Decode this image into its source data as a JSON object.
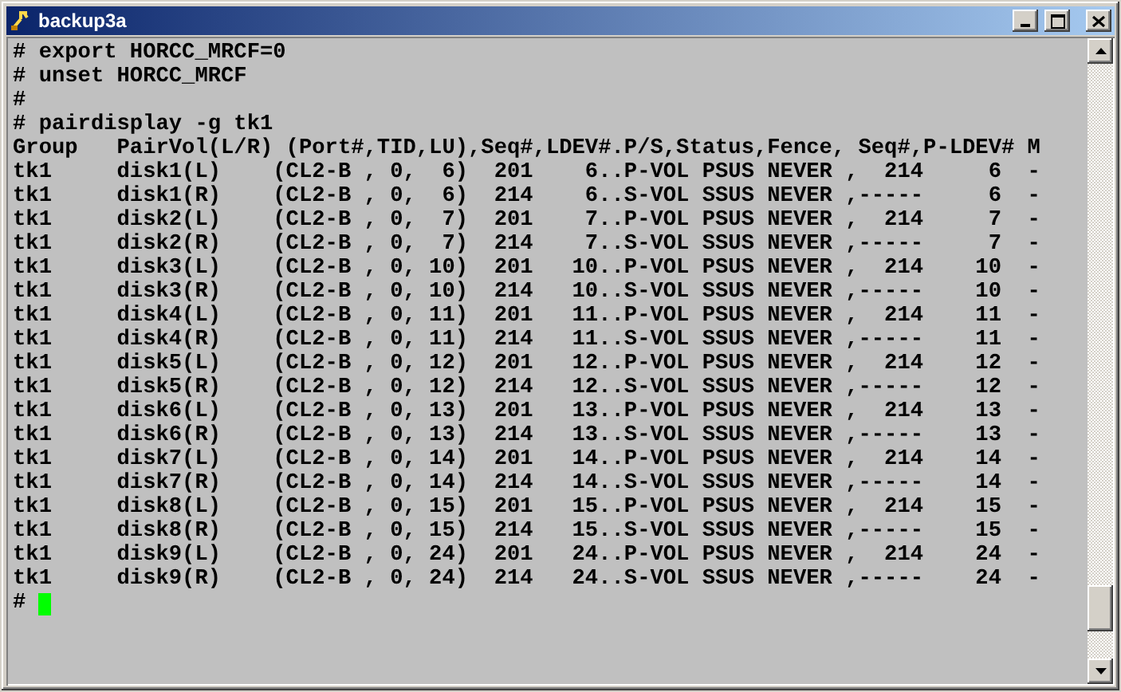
{
  "window": {
    "title": "backup3a"
  },
  "terminal": {
    "lines": [
      "# export HORCC_MRCF=0",
      "# unset HORCC_MRCF",
      "#",
      "# pairdisplay -g tk1",
      "Group   PairVol(L/R) (Port#,TID,LU),Seq#,LDEV#.P/S,Status,Fence, Seq#,P-LDEV# M",
      "tk1     disk1(L)    (CL2-B , 0,  6)  201    6..P-VOL PSUS NEVER ,  214     6  -",
      "tk1     disk1(R)    (CL2-B , 0,  6)  214    6..S-VOL SSUS NEVER ,-----     6  -",
      "tk1     disk2(L)    (CL2-B , 0,  7)  201    7..P-VOL PSUS NEVER ,  214     7  -",
      "tk1     disk2(R)    (CL2-B , 0,  7)  214    7..S-VOL SSUS NEVER ,-----     7  -",
      "tk1     disk3(L)    (CL2-B , 0, 10)  201   10..P-VOL PSUS NEVER ,  214    10  -",
      "tk1     disk3(R)    (CL2-B , 0, 10)  214   10..S-VOL SSUS NEVER ,-----    10  -",
      "tk1     disk4(L)    (CL2-B , 0, 11)  201   11..P-VOL PSUS NEVER ,  214    11  -",
      "tk1     disk4(R)    (CL2-B , 0, 11)  214   11..S-VOL SSUS NEVER ,-----    11  -",
      "tk1     disk5(L)    (CL2-B , 0, 12)  201   12..P-VOL PSUS NEVER ,  214    12  -",
      "tk1     disk5(R)    (CL2-B , 0, 12)  214   12..S-VOL SSUS NEVER ,-----    12  -",
      "tk1     disk6(L)    (CL2-B , 0, 13)  201   13..P-VOL PSUS NEVER ,  214    13  -",
      "tk1     disk6(R)    (CL2-B , 0, 13)  214   13..S-VOL SSUS NEVER ,-----    13  -",
      "tk1     disk7(L)    (CL2-B , 0, 14)  201   14..P-VOL PSUS NEVER ,  214    14  -",
      "tk1     disk7(R)    (CL2-B , 0, 14)  214   14..S-VOL SSUS NEVER ,-----    14  -",
      "tk1     disk8(L)    (CL2-B , 0, 15)  201   15..P-VOL PSUS NEVER ,  214    15  -",
      "tk1     disk8(R)    (CL2-B , 0, 15)  214   15..S-VOL SSUS NEVER ,-----    15  -",
      "tk1     disk9(L)    (CL2-B , 0, 24)  201   24..P-VOL PSUS NEVER ,  214    24  -",
      "tk1     disk9(R)    (CL2-B , 0, 24)  214   24..S-VOL SSUS NEVER ,-----    24  -"
    ],
    "prompt": "#"
  }
}
